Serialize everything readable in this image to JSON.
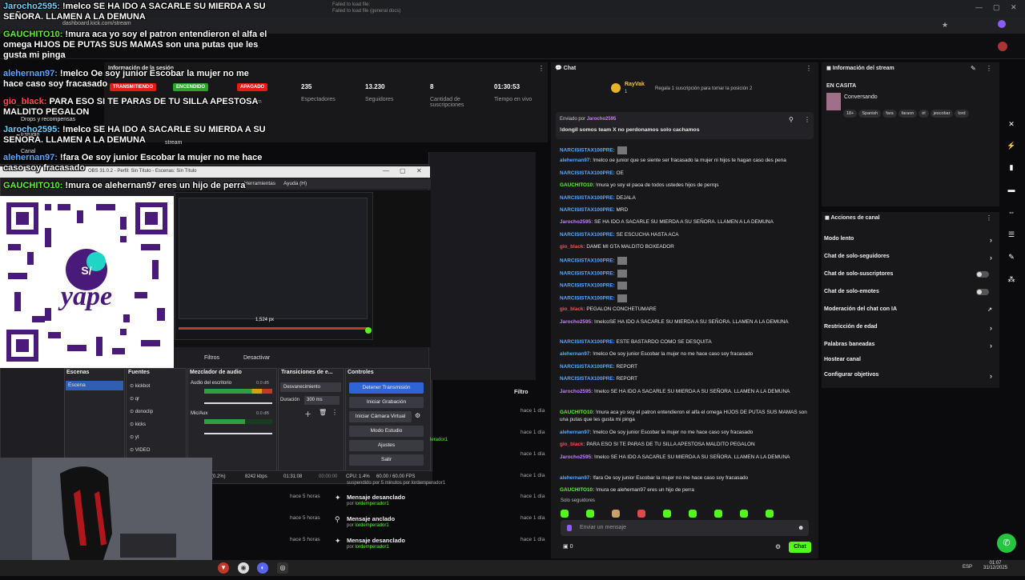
{
  "browser": {
    "url": "dashboard.kick.com/stream",
    "warn1": "Failed to load file: ",
    "warn2": "Failed to load file (general docs)"
  },
  "session": {
    "title": "Información de la sesión",
    "badges": [
      "TRANSMITIENDO",
      "ENCENDIDO",
      "APAGADO"
    ],
    "stats": [
      {
        "value": "235",
        "label": "Espectadores"
      },
      {
        "value": "13.230",
        "label": "Seguidores"
      },
      {
        "value": "8",
        "label": "Cantidad de suscripciones"
      },
      {
        "value": "01:30:53",
        "label": "Tiempo en vivo"
      }
    ],
    "stream_label": "...itstream",
    "report": "REPORT"
  },
  "left_nav": {
    "drops": "Drops y recompensas",
    "studio": "Estudio",
    "canal": "Canal",
    "stream": "stream",
    "report": "REPORT"
  },
  "overlay_chat": [
    {
      "user": "Jarocho2595:",
      "color": "#6cd0ff",
      "text": " !melco SE HA IDO A SACARLE SU MIERDA A SU SEÑORA. LLAMEN A LA DEMUNA"
    },
    {
      "user": "GAUCHITO10:",
      "color": "#53fc18",
      "text": " !mura aca yo soy el patron entendieron el alfa el omega HIJOS DE PUTAS SUS MAMAS son una putas que les gusta mi pinga"
    },
    {
      "user": "alehernan97:",
      "color": "#5aa9ff",
      "text": " !melco Oe soy junior Escobar la mujer no me hace caso soy fracasado"
    },
    {
      "user": "gio_black:",
      "color": "#ff4c4c",
      "text": " PARA ESO SI TE PARAS DE TU SILLA APESTOSA MALDITO PEGALON"
    },
    {
      "user": "Jarocho2595:",
      "color": "#6cd0ff",
      "text": " !melco SE HA IDO A SACARLE SU MIERDA A SU SEÑORA. LLAMEN A LA DEMUNA"
    },
    {
      "user": "alehernan97:",
      "color": "#5aa9ff",
      "text": " !fara Oe soy junior Escobar la mujer no me hace caso soy fracasado"
    },
    {
      "user": "GAUCHITO10:",
      "color": "#53fc18",
      "text": " !mura oe alehernan97 eres un hijo de perra"
    }
  ],
  "obs": {
    "title": "OBS 31.0.2 - Perfil: Sin Título - Escenas: Sin Título",
    "menu": [
      "Herramientas",
      "Ayuda (H)"
    ],
    "preview_readout": "1,524 px",
    "filter_bar": [
      "Filtros",
      "Desactivar"
    ],
    "docks": {
      "scenes": "Escenas",
      "sources": "Fuentes",
      "mixer": "Mezclador de audio",
      "transitions": "Transiciones de e...",
      "controls": "Controles"
    },
    "scene_item": "Escena",
    "sources_list": [
      "kickbot",
      "qr",
      "donoclip",
      "kicks",
      "yt",
      "VIDEO"
    ],
    "mixer": {
      "ch1": "Audio del escritorio",
      "ch1_db": "0.0 dB",
      "ch2": "Mic/Aux",
      "ch2_db": "0.0 dB"
    },
    "transition": {
      "type": "Desvanecimiento",
      "duration_label": "Duración",
      "duration": "300 ms"
    },
    "controls": [
      "Detener Transmisión",
      "Iniciar Grabación",
      "Iniciar Cámara Virtual",
      "Modo Estudio",
      "Ajustes",
      "Salir"
    ],
    "status": {
      "pct": "(0.2%)",
      "kbps": "8242 kbps",
      "time1": "01:31:08",
      "time2": "00:00:00",
      "cpu": "CPU: 1.4%",
      "fps": "60.00 / 60.00 FPS"
    }
  },
  "activity": {
    "filter": "Filtro",
    "times_right": [
      "hace 1 día",
      "hace 1 día",
      "hace 1 día",
      "hace 1 día",
      "hace 1 día"
    ],
    "note": "suspendido por 5 minutos por lordemperador1",
    "user_frag": "lerador1",
    "times_left": [
      "hace 5 horas",
      "hace 5 horas",
      "hace 5 horas"
    ],
    "items": [
      {
        "title": "Mensaje desanclado",
        "by": "por",
        "user": "lordemperador1",
        "time": "hace 1 día"
      },
      {
        "title": "Mensaje anclado",
        "by": "por",
        "user": "lordemperador1",
        "time": "hace 1 día"
      },
      {
        "title": "Mensaje desanclado",
        "by": "por",
        "user": "lordemperador1",
        "time": "hace 1 día"
      }
    ]
  },
  "chat": {
    "title": "Chat",
    "top_user": "RayVak",
    "top_rank": "1",
    "top_note": "Regala 1 suscripción para tomar la posición 2",
    "pinned_by_label": "Enviado por",
    "pinned_user": "Jarocho2595",
    "pinned_text": "!dongil somos team X no perdonamos solo cachamos",
    "messages": [
      {
        "user": "NARCISISTAX100PRE:",
        "color": "#5aa9ff",
        "text": ""
      },
      {
        "user": "alehernan97:",
        "color": "#5aa9ff",
        "text": " !melco oe junior que se siente ser fracasado la mujer ni hijos te hagan caso des pena"
      },
      {
        "user": "NARCISISTAX100PRE:",
        "color": "#5aa9ff",
        "text": " OE"
      },
      {
        "user": "GAUCHITO10:",
        "color": "#53fc18",
        "text": " !mura yo soy el paoa de todos ustedes hijos de perrqs"
      },
      {
        "user": "NARCISISTAX100PRE:",
        "color": "#5aa9ff",
        "text": " DEJALA"
      },
      {
        "user": "NARCISISTAX100PRE:",
        "color": "#5aa9ff",
        "text": " MRD"
      },
      {
        "user": "Jarocho2595:",
        "color": "#c77dff",
        "text": " SE HA IDO A SACARLE SU MIERDA A SU SEÑORA. LLAMEN A LA DEMUNA"
      },
      {
        "user": "NARCISISTAX100PRE:",
        "color": "#5aa9ff",
        "text": " SE ESCUCHA HASTA ACA"
      },
      {
        "user": "gio_black:",
        "color": "#ff4c4c",
        "text": " DAME MI GTA MALDITO BOXEADOR"
      },
      {
        "user": "NARCISISTAX100PRE:",
        "color": "#5aa9ff",
        "text": ""
      },
      {
        "user": "NARCISISTAX100PRE:",
        "color": "#5aa9ff",
        "text": ""
      },
      {
        "user": "NARCISISTAX100PRE:",
        "color": "#5aa9ff",
        "text": ""
      },
      {
        "user": "NARCISISTAX100PRE:",
        "color": "#5aa9ff",
        "text": ""
      },
      {
        "user": "gio_black:",
        "color": "#ff4c4c",
        "text": " PEGALON CONCHETUMARE"
      },
      {
        "user": "Jarocho2595:",
        "color": "#c77dff",
        "text": " !melcoSE HA IDO A SACARLE SU MIERDA A SU SEÑORA. LLAMEN A LA DEMUNA"
      },
      {
        "user": "NARCISISTAX100PRE:",
        "color": "#5aa9ff",
        "text": " ESTE BASTARDO COMO SE DESQUITA"
      },
      {
        "user": "alehernan97:",
        "color": "#5aa9ff",
        "text": " !melco Oe soy junior Escobar la mujer no me hace caso soy fracasado"
      },
      {
        "user": "NARCISISTAX100PRE:",
        "color": "#5aa9ff",
        "text": " REPORT"
      },
      {
        "user": "NARCISISTAX100PRE:",
        "color": "#5aa9ff",
        "text": " REPORT"
      },
      {
        "user": "Jarocho2595:",
        "color": "#c77dff",
        "text": " !melco SE HA IDO A SACARLE SU MIERDA A SU SEÑORA. LLAMEN A LA DEMUNA"
      },
      {
        "user": "GAUCHITO10:",
        "color": "#53fc18",
        "text": " !mura aca yo soy el patron entendieron el alfa el omega HIJOS DE PUTAS SUS MAMAS son una putas que les gusta mi pinga"
      },
      {
        "user": "alehernan97:",
        "color": "#5aa9ff",
        "text": " !melco Oe soy junior Escobar la mujer no me hace caso soy fracasado"
      },
      {
        "user": "gio_black:",
        "color": "#ff4c4c",
        "text": " PARA ESO SI TE PARAS DE TU SILLA APESTOSA MALDITO PEGALON"
      },
      {
        "user": "Jarocho2595:",
        "color": "#c77dff",
        "text": " !melco SE HA IDO A SACARLE SU MIERDA A SU SEÑORA. LLAMEN A LA DEMUNA"
      },
      {
        "user": "alehernan97:",
        "color": "#5aa9ff",
        "text": " !fara Oe soy junior Escobar la mujer no me hace caso soy fracasado"
      },
      {
        "user": "GAUCHITO10:",
        "color": "#53fc18",
        "text": " !mura oe alehernan97 eres un hijo de perra"
      }
    ],
    "followers_only": "Solo seguidores",
    "input_placeholder": "Enviar un mensaje",
    "counter": "0",
    "send": "Chat"
  },
  "stream_info": {
    "title": "Información del stream",
    "status": "EN CASITA",
    "category": "Conversando",
    "tags": [
      "18+",
      "Spanish",
      "fara",
      "faraon",
      "irl",
      "jescobar",
      "lord"
    ]
  },
  "channel_actions": {
    "title": "Acciones de canal",
    "rows": [
      {
        "label": "Modo lento",
        "kind": "chevron"
      },
      {
        "label": "Chat de solo-seguidores",
        "kind": "chevron"
      },
      {
        "label": "Chat de solo-suscriptores",
        "kind": "toggle"
      },
      {
        "label": "Chat de solo-emotes",
        "kind": "toggle"
      },
      {
        "label": "Moderación del chat con IA",
        "kind": "external"
      },
      {
        "label": "Restricción de edad",
        "kind": "chevron"
      },
      {
        "label": "Palabras baneadas",
        "kind": "chevron"
      },
      {
        "label": "Hostear canal",
        "kind": "none"
      },
      {
        "label": "Configurar objetivos",
        "kind": "chevron"
      }
    ]
  },
  "qr": {
    "brand": "yape",
    "logo": "S/"
  },
  "taskbar": {
    "lang": "ESP",
    "time": "01:07",
    "date": "31/12/2025"
  },
  "colors": {
    "kick_green": "#53fc18",
    "panel": "#18181b",
    "red_badge": "#e91916"
  }
}
